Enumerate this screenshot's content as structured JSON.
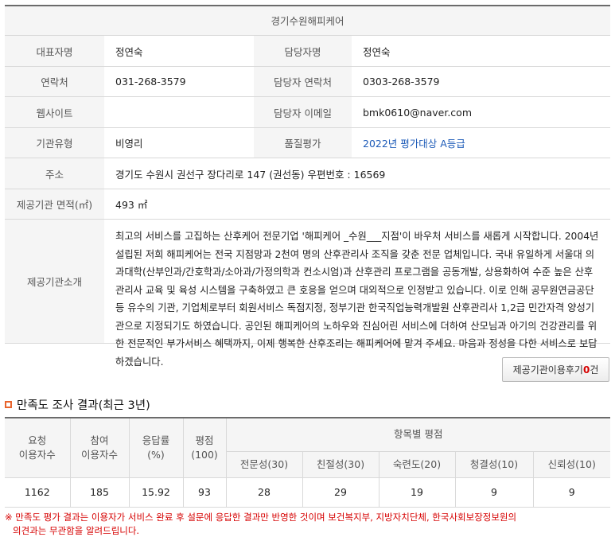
{
  "org": {
    "title": "경기수원해피케어",
    "rows": {
      "rep_label": "대표자명",
      "rep_value": "정연숙",
      "mgr_label": "담당자명",
      "mgr_value": "정연숙",
      "contact_label": "연락처",
      "contact_value": "031-268-3579",
      "mgr_contact_label": "담당자 연락처",
      "mgr_contact_value": "0303-268-3579",
      "website_label": "웹사이트",
      "website_value": "",
      "mgr_email_label": "담당자 이메일",
      "mgr_email_value": "bmk0610@naver.com",
      "type_label": "기관유형",
      "type_value": "비영리",
      "quality_label": "품질평가",
      "quality_value": "2022년 평가대상 A등급",
      "address_label": "주소",
      "address_value": "경기도 수원시 권선구 장다리로 147 (권선동)  우편번호 : 16569",
      "area_label": "제공기관 면적(㎡)",
      "area_value": "493 ㎡",
      "intro_label": "제공기관소개",
      "intro_value": "최고의 서비스를 고집하는 산후케어 전문기업 '해피케어 _수원___지점'이 바우처 서비스를 새롭게 시작합니다. 2004년 설립된 저희 해피케어는 전국 지점망과 2천여 명의 산후관리사 조직을 갖춘 전문 업체입니다. 국내 유일하게 서울대 의과대학(산부인과/간호학과/소아과/가정의학과 컨소시엄)과 산후관리 프로그램을 공동개발, 상용화하여 수준 높은 산후관리사 교육 및 육성 시스템을 구축하였고 큰 호응을 얻으며 대외적으로 인정받고 있습니다. 이로 인해 공무원연금공단 등 유수의 기관, 기업체로부터 회원서비스 독점지정, 정부기관 한국직업능력개발원 산후관리사 1,2급 민간자격 양성기관으로 지정되기도 하였습니다. 공인된 해피케어의 노하우와 진심어린 서비스에 더하여 산모님과 아기의 건강관리를 위한 전문적인 부가서비스 혜택까지, 이제 행복한 산후조리는 해피케어에 맡겨 주세요. 마음과 정성을 다한 서비스로 보답하겠습니다."
    }
  },
  "review_button": {
    "label": "제공기관이용후기",
    "count": "0",
    "suffix": "건"
  },
  "satisfaction": {
    "title": "만족도 조사 결과(최근 3년)",
    "headers": {
      "requests_l1": "요청",
      "requests_l2": "이용자수",
      "participants_l1": "참여",
      "participants_l2": "이용자수",
      "rate_l1": "응답률",
      "rate_l2": "(%)",
      "score_l1": "평점",
      "score_l2": "(100)",
      "item_scores": "항목별 평점",
      "expertise": "전문성(30)",
      "kindness": "친절성(30)",
      "skill": "숙련도(20)",
      "cleanliness": "청결성(10)",
      "trust": "신뢰성(10)"
    },
    "values": {
      "requests": "1162",
      "participants": "185",
      "rate": "15.92",
      "score": "93",
      "expertise": "28",
      "kindness": "29",
      "skill": "19",
      "cleanliness": "9",
      "trust": "9"
    }
  },
  "note": {
    "line1": "※ 만족도 평가 결과는 이용자가 서비스 완료 후 설문에 응답한 결과만 반영한 것이며 보건복지부, 지방자치단체, 한국사회보장정보원의",
    "line2": "의견과는 무관함을 알려드립니다."
  },
  "colors": {
    "accent_red": "#d60000",
    "link_blue": "#1d5bb8",
    "bullet_orange": "#e8642c",
    "header_bg": "#f5f5f5"
  }
}
